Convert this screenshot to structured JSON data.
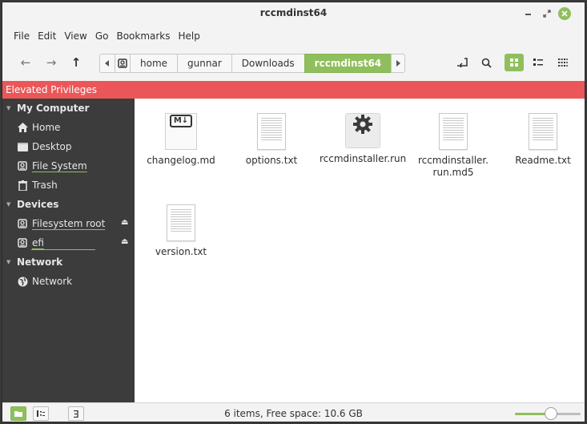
{
  "window": {
    "title": "rccmdinst64"
  },
  "menubar": {
    "items": [
      "File",
      "Edit",
      "View",
      "Go",
      "Bookmarks",
      "Help"
    ]
  },
  "pathbar": {
    "segments": [
      "home",
      "gunnar",
      "Downloads",
      "rccmdinst64"
    ]
  },
  "banner": {
    "text": "Elevated Privileges"
  },
  "sidebar": {
    "sections": [
      {
        "title": "My Computer",
        "items": [
          {
            "label": "Home",
            "icon": "home-icon"
          },
          {
            "label": "Desktop",
            "icon": "desktop-icon"
          },
          {
            "label": "File System",
            "icon": "drive-icon"
          },
          {
            "label": "Trash",
            "icon": "trash-icon"
          }
        ]
      },
      {
        "title": "Devices",
        "items": [
          {
            "label": "Filesystem root",
            "icon": "drive-icon"
          },
          {
            "label": "efi",
            "icon": "drive-icon"
          }
        ]
      },
      {
        "title": "Network",
        "items": [
          {
            "label": "Network",
            "icon": "network-icon"
          }
        ]
      }
    ]
  },
  "files": [
    {
      "name": "changelog.md",
      "icon": "markdown-icon"
    },
    {
      "name": "options.txt",
      "icon": "text-file-icon"
    },
    {
      "name": "rccmdinstaller.run",
      "icon": "executable-gear-icon"
    },
    {
      "name": "rccmdinstaller.\nrun.md5",
      "line1": "rccmdinstaller.",
      "line2": "run.md5",
      "icon": "text-file-icon"
    },
    {
      "name": "Readme.txt",
      "icon": "text-file-icon"
    },
    {
      "name": "version.txt",
      "icon": "text-file-icon"
    }
  ],
  "statusbar": {
    "text": "6 items, Free space: 10.6 GB",
    "zoom_level": 0.55
  },
  "colors": {
    "accent": "#8fbf5c",
    "banner": "#eb5759",
    "sidebar": "#3c3c3c"
  }
}
